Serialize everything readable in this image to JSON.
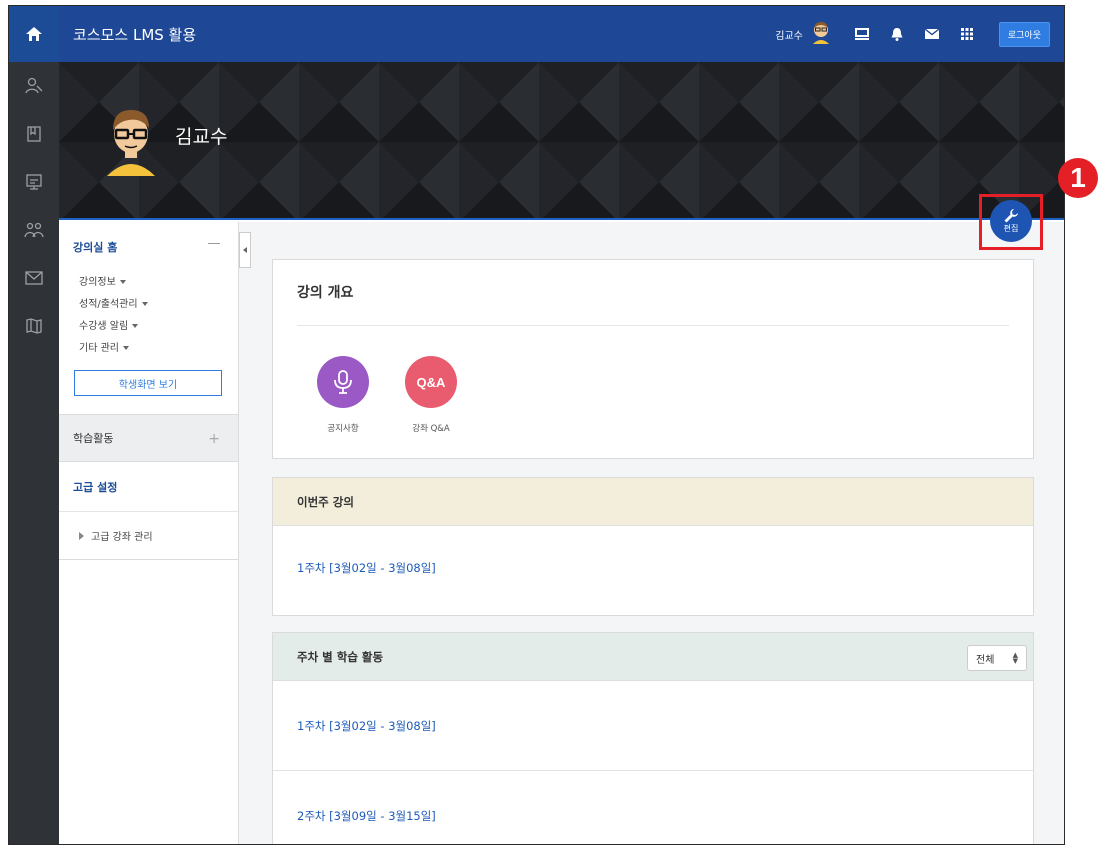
{
  "topbar": {
    "title": "코스모스 LMS 활용",
    "user_name": "김교수",
    "logout_label": "로그아웃"
  },
  "profile": {
    "name": "김교수"
  },
  "edit": {
    "label": "편집",
    "badge": "1"
  },
  "sidebar": {
    "home_label": "강의실 홈",
    "menu": [
      "강의정보",
      "성적/출석관리",
      "수강생 알림",
      "기타 관리"
    ],
    "student_view_label": "학생화면 보기",
    "activity_label": "학습활동",
    "advanced_label": "고급 설정",
    "advanced_sub": "고급 강좌 관리"
  },
  "overview": {
    "title": "강의 개요",
    "activities": [
      {
        "label": "공지사항",
        "icon": "microphone-icon",
        "color": "#9b59c6"
      },
      {
        "label": "강좌 Q&A",
        "icon_text": "Q&A",
        "color": "#e95b6e"
      }
    ]
  },
  "this_week": {
    "title": "이번주 강의",
    "week": "1주차 [3월02일 - 3월08일]"
  },
  "weekly": {
    "title": "주차 별 학습 활동",
    "filter_value": "전체",
    "weeks": [
      "1주차 [3월02일 - 3월08일]",
      "2주차 [3월09일 - 3월15일]"
    ]
  },
  "colors": {
    "topbar": "#1e4796",
    "rail": "#2f3338",
    "accent": "#2f7de1",
    "highlight": "#e41f26"
  }
}
